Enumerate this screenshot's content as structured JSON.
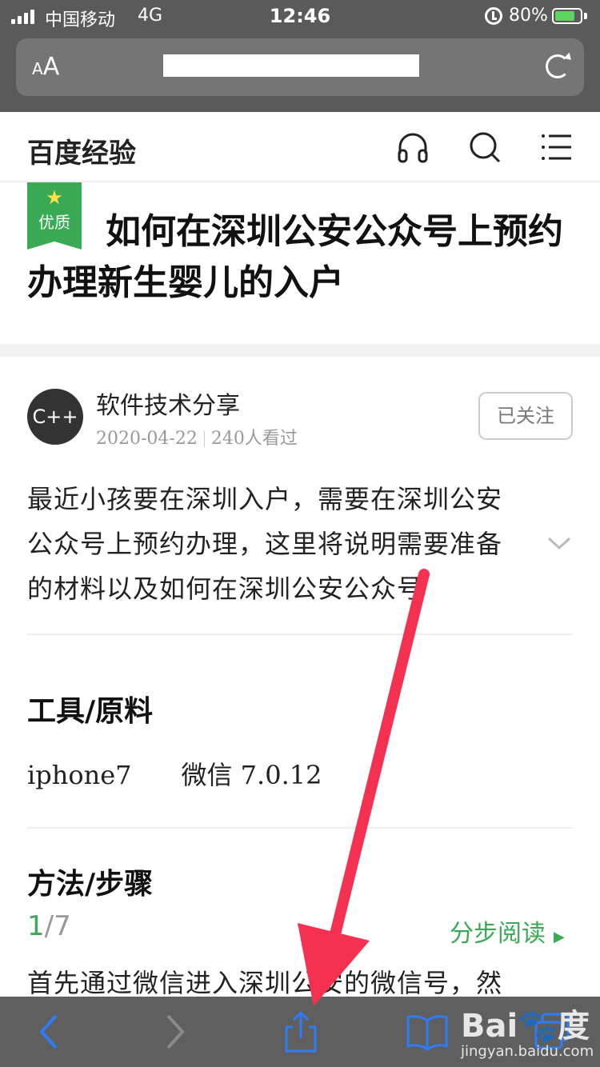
{
  "status": {
    "carrier": "中国移动",
    "network": "4G",
    "time": "12:46",
    "battery": "80%",
    "battery_level": 0.8
  },
  "browser": {
    "text_size_label": "AA"
  },
  "site": {
    "brand": "百度经验"
  },
  "article": {
    "badge": "优质",
    "title": "如何在深圳公安公众号上预约办理新生婴儿的入户",
    "author": "软件技术分享",
    "avatar_text": "C++",
    "date": "2020-04-22",
    "views": "240人看过",
    "follow_label": "已关注",
    "summary": "最近小孩要在深圳入户，需要在深圳公安公众号上预约办理，这里将说明需要准备的材料以及如何在深圳公安公众号",
    "tools_heading": "工具/原料",
    "tools": [
      "iphone7",
      "微信 7.0.12"
    ],
    "steps_heading": "方法/步骤",
    "step_current": "1",
    "step_total": "/7",
    "read_by_step": "分步阅读",
    "step_text": "首先通过微信进入深圳公安的微信号，然"
  },
  "watermark": {
    "logo": "Bai",
    "logo_tail": "度",
    "site": "jingyan.baidu.com"
  },
  "colors": {
    "accent_green": "#3aaa55",
    "ios_blue": "#2f7cf6",
    "arrow_red": "#f43150",
    "chrome_gray": "#5a5a5a"
  }
}
